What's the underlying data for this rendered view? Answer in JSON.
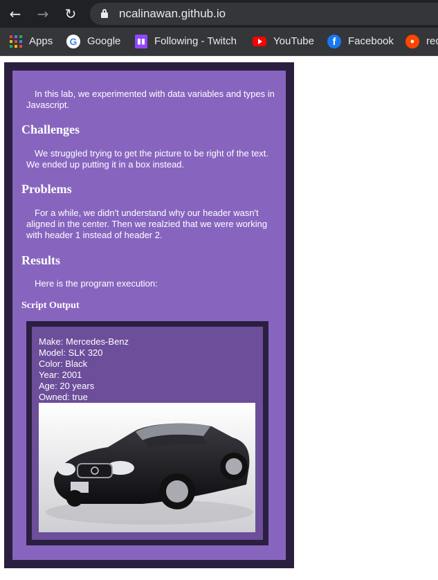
{
  "browser": {
    "url": "ncalinawan.github.io",
    "bookmarks": [
      {
        "label": "Apps",
        "icon": "apps-grid-icon"
      },
      {
        "label": "Google",
        "icon": "google-icon"
      },
      {
        "label": "Following - Twitch",
        "icon": "twitch-icon"
      },
      {
        "label": "YouTube",
        "icon": "youtube-icon"
      },
      {
        "label": "Facebook",
        "icon": "facebook-icon"
      },
      {
        "label": "red",
        "icon": "reddit-icon"
      }
    ]
  },
  "page": {
    "intro": "In this lab, we experimented with data variables and types in Javascript.",
    "sections": [
      {
        "heading": "Challenges",
        "body": "We struggled trying to get the picture to be right of the text. We ended up putting it in a box instead."
      },
      {
        "heading": "Problems",
        "body": "For a while, we didn't understand why our header wasn't aligned in the center. Then we realzied that we were working with header 1 instead of header 2."
      },
      {
        "heading": "Results",
        "body": "Here is the program execution:"
      }
    ],
    "script_output_heading": "Script Output",
    "output_lines": [
      "Make: Mercedes-Benz",
      "Model: SLK 320",
      "Color: Black",
      "Year: 2001",
      "Age: 20 years",
      "Owned: true"
    ]
  },
  "colors": {
    "outer_border": "#2b1f40",
    "panel": "#8765bf",
    "script_inner": "#6c4e9a"
  }
}
